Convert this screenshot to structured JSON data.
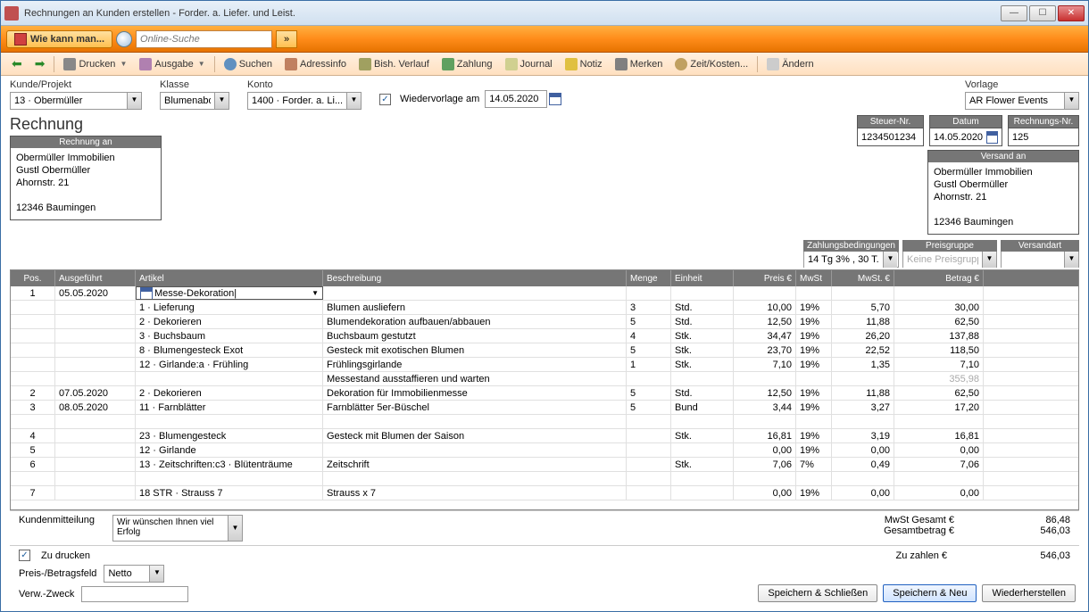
{
  "window": {
    "title": "Rechnungen an Kunden erstellen - Forder. a. Liefer. und Leist."
  },
  "ribbon": {
    "help_label": "Wie kann man...",
    "search_placeholder": "Online-Suche",
    "expand": "»"
  },
  "toolbar": {
    "print": "Drucken",
    "output": "Ausgabe",
    "find": "Suchen",
    "address": "Adressinfo",
    "history": "Bish. Verlauf",
    "payment": "Zahlung",
    "journal": "Journal",
    "note": "Notiz",
    "remember": "Merken",
    "timecost": "Zeit/Kosten...",
    "change": "Ändern"
  },
  "top": {
    "customer_label": "Kunde/Projekt",
    "customer_value": "13 · Obermüller",
    "class_label": "Klasse",
    "class_value": "Blumenabo",
    "account_label": "Konto",
    "account_value": "1400 · Forder. a. Li...",
    "resubmit_label": "Wiedervorlage am",
    "resubmit_date": "14.05.2020",
    "template_label": "Vorlage",
    "template_value": "AR Flower Events"
  },
  "invoice": {
    "heading": "Rechnung",
    "billto_hdr": "Rechnung an",
    "billto_lines": "Obermüller Immobilien\nGustl Obermüller\nAhornstr. 21\n\n12346 Baumingen",
    "shipto_hdr": "Versand an",
    "shipto_lines": "Obermüller Immobilien\nGustl Obermüller\nAhornstr. 21\n\n12346 Baumingen",
    "taxno_hdr": "Steuer-Nr.",
    "taxno": "1234501234",
    "date_hdr": "Datum",
    "date": "14.05.2020",
    "invno_hdr": "Rechnungs-Nr.",
    "invno": "125"
  },
  "paybar": {
    "terms_hdr": "Zahlungsbedingungen",
    "terms": "14 Tg 3% , 30 T...",
    "pricegroup_hdr": "Preisgruppe",
    "pricegroup": "Keine Preisgruppe",
    "shipmethod_hdr": "Versandart",
    "shipmethod": ""
  },
  "cols": {
    "pos": "Pos.",
    "date": "Ausgeführt",
    "item": "Artikel",
    "desc": "Beschreibung",
    "qty": "Menge",
    "unit": "Einheit",
    "price": "Preis €",
    "vat": "MwSt",
    "vate": "MwSt. €",
    "total": "Betrag €"
  },
  "rows": [
    {
      "pos": "1",
      "date": "05.05.2020",
      "item": "Messe-Dekoration|",
      "desc": "",
      "qty": "",
      "unit": "",
      "price": "",
      "vat": "",
      "vate": "",
      "total": "",
      "edit": true
    },
    {
      "pos": "",
      "date": "",
      "item": "1 · Lieferung",
      "desc": "Blumen ausliefern",
      "qty": "3",
      "unit": "Std.",
      "price": "10,00",
      "vat": "19%",
      "vate": "5,70",
      "total": "30,00"
    },
    {
      "pos": "",
      "date": "",
      "item": "2 · Dekorieren",
      "desc": "Blumendekoration aufbauen/abbauen",
      "qty": "5",
      "unit": "Std.",
      "price": "12,50",
      "vat": "19%",
      "vate": "11,88",
      "total": "62,50"
    },
    {
      "pos": "",
      "date": "",
      "item": "3 · Buchsbaum",
      "desc": "Buchsbaum gestutzt",
      "qty": "4",
      "unit": "Stk.",
      "price": "34,47",
      "vat": "19%",
      "vate": "26,20",
      "total": "137,88"
    },
    {
      "pos": "",
      "date": "",
      "item": "8 · Blumengesteck Exot",
      "desc": "Gesteck mit exotischen Blumen",
      "qty": "5",
      "unit": "Stk.",
      "price": "23,70",
      "vat": "19%",
      "vate": "22,52",
      "total": "118,50"
    },
    {
      "pos": "",
      "date": "",
      "item": "12 · Girlande:a · Frühling",
      "desc": "Frühlingsgirlande",
      "qty": "1",
      "unit": "Stk.",
      "price": "7,10",
      "vat": "19%",
      "vate": "1,35",
      "total": "7,10"
    },
    {
      "pos": "",
      "date": "",
      "item": "",
      "desc": "Messestand ausstaffieren und warten",
      "qty": "",
      "unit": "",
      "price": "",
      "vat": "",
      "vate": "",
      "total": "355,98",
      "dim": true
    },
    {
      "pos": "2",
      "date": "07.05.2020",
      "item": "2 · Dekorieren",
      "desc": "Dekoration für Immobilienmesse",
      "qty": "5",
      "unit": "Std.",
      "price": "12,50",
      "vat": "19%",
      "vate": "11,88",
      "total": "62,50"
    },
    {
      "pos": "3",
      "date": "08.05.2020",
      "item": "11 · Farnblätter",
      "desc": "Farnblätter 5er-Büschel",
      "qty": "5",
      "unit": "Bund",
      "price": "3,44",
      "vat": "19%",
      "vate": "3,27",
      "total": "17,20"
    },
    {
      "pos": "",
      "date": "",
      "item": "",
      "desc": "",
      "qty": "",
      "unit": "",
      "price": "",
      "vat": "",
      "vate": "",
      "total": ""
    },
    {
      "pos": "4",
      "date": "",
      "item": "23 · Blumengesteck",
      "desc": "Gesteck mit Blumen der Saison",
      "qty": "",
      "unit": "Stk.",
      "price": "16,81",
      "vat": "19%",
      "vate": "3,19",
      "total": "16,81"
    },
    {
      "pos": "5",
      "date": "",
      "item": "12 · Girlande",
      "desc": "",
      "qty": "",
      "unit": "",
      "price": "0,00",
      "vat": "19%",
      "vate": "0,00",
      "total": "0,00"
    },
    {
      "pos": "6",
      "date": "",
      "item": "13 · Zeitschriften:c3 · Blütenträume",
      "desc": "Zeitschrift",
      "qty": "",
      "unit": "Stk.",
      "price": "7,06",
      "vat": "7%",
      "vate": "0,49",
      "total": "7,06"
    },
    {
      "pos": "",
      "date": "",
      "item": "",
      "desc": "",
      "qty": "",
      "unit": "",
      "price": "",
      "vat": "",
      "vate": "",
      "total": ""
    },
    {
      "pos": "7",
      "date": "",
      "item": "18 STR · Strauss 7",
      "desc": "Strauss x 7",
      "qty": "",
      "unit": "",
      "price": "0,00",
      "vat": "19%",
      "vate": "0,00",
      "total": "0,00"
    }
  ],
  "footer": {
    "msg_label": "Kundenmitteilung",
    "msg_value": "Wir wünschen Ihnen viel Erfolg",
    "vat_total_label": "MwSt Gesamt €",
    "vat_total": "86,48",
    "grand_total_label": "Gesamtbetrag €",
    "grand_total": "546,03",
    "due_label": "Zu zahlen €",
    "due": "546,03",
    "toprint_label": "Zu drucken",
    "pricefield_label": "Preis-/Betragsfeld",
    "pricefield_value": "Netto",
    "purpose_label": "Verw.-Zweck"
  },
  "buttons": {
    "saveclose": "Speichern & Schließen",
    "savenew": "Speichern & Neu",
    "restore": "Wiederherstellen"
  }
}
